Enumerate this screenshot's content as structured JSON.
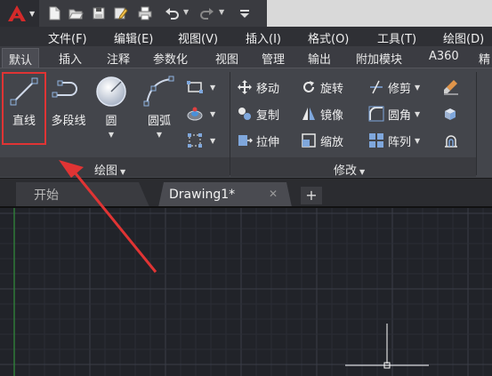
{
  "quick_access": {
    "icons": [
      "new-icon",
      "open-icon",
      "save-icon",
      "save-as-icon",
      "print-icon",
      "undo-icon",
      "redo-icon",
      "customize-icon"
    ]
  },
  "menu": {
    "items": [
      "文件(F)",
      "编辑(E)",
      "视图(V)",
      "插入(I)",
      "格式(O)",
      "工具(T)",
      "绘图(D)"
    ]
  },
  "ribbon_tabs": {
    "items": [
      "默认",
      "插入",
      "注释",
      "参数化",
      "视图",
      "管理",
      "输出",
      "附加模块",
      "A360",
      "精"
    ]
  },
  "draw_panel": {
    "title": "绘图",
    "line": "直线",
    "polyline": "多段线",
    "circle": "圆",
    "arc": "圆弧"
  },
  "modify_panel": {
    "title": "修改",
    "move": "移动",
    "rotate": "旋转",
    "trim": "修剪",
    "copy": "复制",
    "mirror": "镜像",
    "fillet": "圆角",
    "stretch": "拉伸",
    "scale": "缩放",
    "array": "阵列"
  },
  "doc_tabs": {
    "start": "开始",
    "drawing": "Drawing1*",
    "close": "✕",
    "new": "+"
  },
  "colors": {
    "highlight": "#e03434",
    "ribbon": "#43454b",
    "canvas": "#212329"
  }
}
